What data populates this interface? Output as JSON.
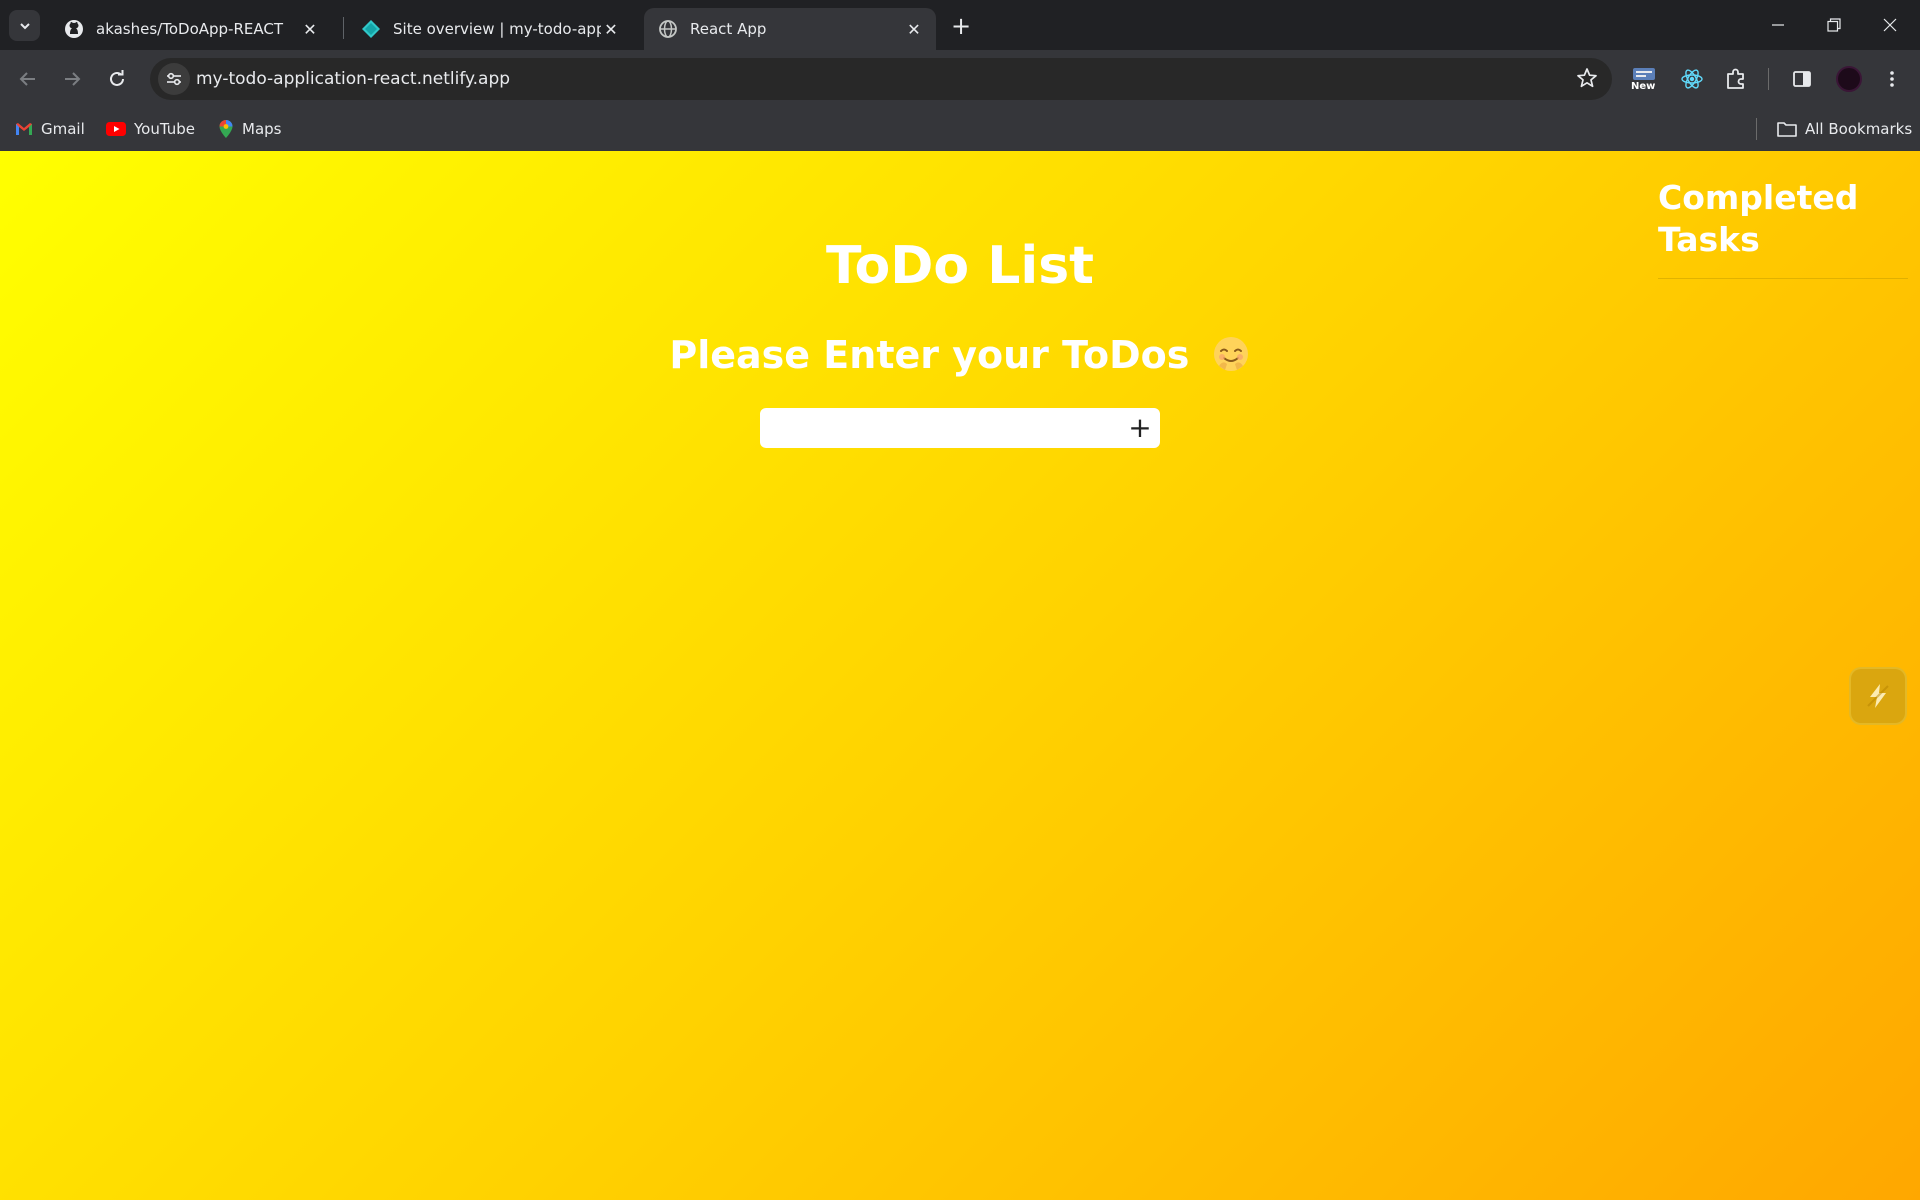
{
  "browser": {
    "tabs": [
      {
        "title": "akashes/ToDoApp-REACT",
        "icon": "github-icon",
        "active": false
      },
      {
        "title": "Site overview | my-todo-applica",
        "icon": "netlify-icon",
        "active": false
      },
      {
        "title": "React App",
        "icon": "globe-icon",
        "active": true
      }
    ],
    "url": "my-todo-application-react.netlify.app",
    "new_badge": "New",
    "bookmarks": [
      {
        "label": "Gmail",
        "icon": "gmail-icon"
      },
      {
        "label": "YouTube",
        "icon": "youtube-icon"
      },
      {
        "label": "Maps",
        "icon": "maps-icon"
      }
    ],
    "all_bookmarks": "All Bookmarks",
    "colors": {
      "chrome_dark": "#202124",
      "toolbar": "#35363a"
    }
  },
  "app": {
    "title": "ToDo List",
    "subtitle": "Please Enter your ToDos",
    "subtitle_emoji": "smiling-face-emoji",
    "input_value": "",
    "add_label": "+",
    "completed_title": "Completed Tasks",
    "colors": {
      "gradient_start": "#ffff00",
      "gradient_end": "#ffa700",
      "text": "#ffffff"
    }
  }
}
